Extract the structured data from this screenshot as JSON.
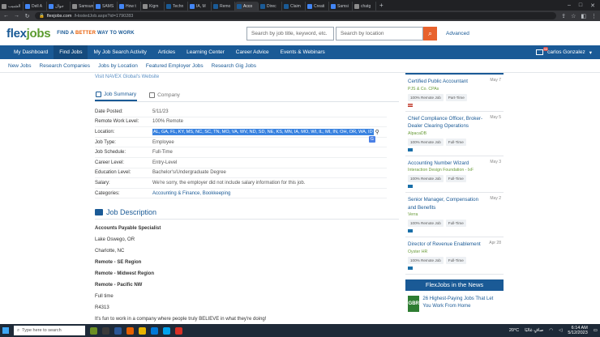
{
  "browser": {
    "tabs": [
      {
        "label": "الشبيب",
        "active": false
      },
      {
        "label": "Dell A",
        "active": false
      },
      {
        "label": "جوال",
        "active": false
      },
      {
        "label": "Samsun",
        "active": false
      },
      {
        "label": "SAMS",
        "active": false
      },
      {
        "label": "How t",
        "active": false
      },
      {
        "label": "Kigm",
        "active": false
      },
      {
        "label": "Techn",
        "active": false
      },
      {
        "label": "IA, M",
        "active": false
      },
      {
        "label": "Remo",
        "active": false
      },
      {
        "label": "Acco",
        "active": true
      },
      {
        "label": "Direc",
        "active": false
      },
      {
        "label": "Claim",
        "active": false
      },
      {
        "label": "Creati",
        "active": false
      },
      {
        "label": "Samsi",
        "active": false
      },
      {
        "label": "chatg",
        "active": false
      }
    ],
    "url_host": "flexjobs.com",
    "url_path": "/HostedJob.aspx?id=1790283"
  },
  "header": {
    "logo_flex": "flex",
    "logo_jobs": "jobs",
    "tagline_pre": "FIND A",
    "tagline_better": "BETTER",
    "tagline_post": "WAY TO WORK",
    "search_placeholder": "Search by job title, keyword, etc.",
    "location_placeholder": "Search by location",
    "advanced": "Advanced"
  },
  "nav": {
    "items": [
      "My Dashboard",
      "Find Jobs",
      "My Job Search Activity",
      "Articles",
      "Learning Center",
      "Career Advice",
      "Events & Webinars"
    ],
    "user_name": "carlos Gonzalez",
    "mail_badge": "99"
  },
  "subnav": {
    "items": [
      "New Jobs",
      "Research Companies",
      "Jobs by Location",
      "Featured Employer Jobs",
      "Research Gig Jobs"
    ]
  },
  "job": {
    "visit_link": "Visit NAVEX Global's Website",
    "tab_summary": "Job Summary",
    "tab_company": "Company",
    "summary": [
      {
        "label": "Date Posted:",
        "value": "5/11/23"
      },
      {
        "label": "Remote Work Level:",
        "value": "100% Remote"
      },
      {
        "label": "Location:",
        "value": "AL, GA, FL, KY, MS, NC, SC, TN, MO, VA, WV, ND, SD, NE, KS, MN, IA, MO, WI, IL, MI, IN, OH, OR, WA, ID"
      },
      {
        "label": "Job Type:",
        "value": "Employee"
      },
      {
        "label": "Job Schedule:",
        "value": "Full-Time"
      },
      {
        "label": "Career Level:",
        "value": "Entry-Level"
      },
      {
        "label": "Education Level:",
        "value": "Bachelor's/Undergraduate Degree"
      },
      {
        "label": "Salary:",
        "value": "We're sorry, the employer did not include salary information for this job."
      },
      {
        "label": "Categories:",
        "value": "Accounting & Finance, Bookkeeping"
      }
    ],
    "description_title": "Job Description",
    "description": [
      {
        "text": "Accounts Payable Specialist",
        "bold": true
      },
      {
        "text": "Lake Oswego, OR",
        "bold": false
      },
      {
        "text": "Charlotte, NC",
        "bold": false
      },
      {
        "text": "Remote - SE Region",
        "bold": true
      },
      {
        "text": "Remote - Midwest Region",
        "bold": true
      },
      {
        "text": "Remote - Pacific NW",
        "bold": true
      },
      {
        "text": "Full time",
        "bold": false
      },
      {
        "text": "R4313",
        "bold": false
      },
      {
        "text": "It's fun to work in a company where people truly BELIEVE in what they're doing!",
        "bold": false
      }
    ]
  },
  "sidebar": {
    "jobs": [
      {
        "title": "Certified Public Accountant",
        "date": "May 7",
        "company": "PJS & Co. CPAs",
        "tags": [
          "100% Remote Job",
          "Part-Time"
        ],
        "flag": "us"
      },
      {
        "title": "Chief Compliance Officer, Broker-Dealer Clearing Operations",
        "date": "May 5",
        "company": "AlpacaDB",
        "tags": [
          "100% Remote Job",
          "Full-Time"
        ],
        "flag": "globe"
      },
      {
        "title": "Accounting Number Wizard",
        "date": "May 3",
        "company": "Interaction Design Foundation - IxF",
        "tags": [
          "100% Remote Job",
          "Full-Time"
        ],
        "flag": "globe"
      },
      {
        "title": "Senior Manager, Compensation and Benefits",
        "date": "May 2",
        "company": "Verra",
        "tags": [
          "100% Remote Job",
          "Full-Time"
        ],
        "flag": "globe"
      },
      {
        "title": "Director of Revenue Enablement",
        "date": "Apr 28",
        "company": "Oyster HR",
        "tags": [
          "100% Remote Job",
          "Full-Time"
        ],
        "flag": "globe"
      }
    ],
    "news_header": "FlexJobs in the News",
    "news_thumb": "GBR",
    "news_text": "26 Highest-Paying Jobs That Let You Work From Home"
  },
  "taskbar": {
    "search_placeholder": "Type here to search",
    "weather": "20°C",
    "weather_desc": "صافٍ غالبًا",
    "time": "6:14 AM",
    "date": "5/12/2023"
  }
}
